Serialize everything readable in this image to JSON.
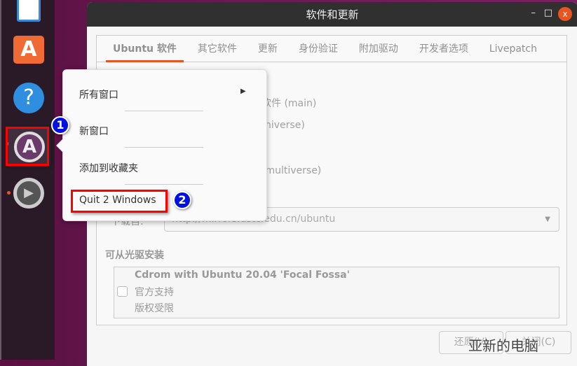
{
  "window": {
    "title": "软件和更新",
    "minimize": "–",
    "maximize": "□",
    "close": "x"
  },
  "tabs": [
    {
      "label": "Ubuntu 软件",
      "active": true
    },
    {
      "label": "其它软件"
    },
    {
      "label": "更新"
    },
    {
      "label": "身份验证"
    },
    {
      "label": "附加驱动"
    },
    {
      "label": "开发者选项"
    },
    {
      "label": "Livepatch"
    }
  ],
  "background_content": {
    "main": "软件 (main)",
    "universe": "niverse)",
    "multiverse": "(multiverse)",
    "download_label": "下载自:",
    "download_server": "http://mirrors.ustc.edu.cn/ubuntu"
  },
  "cdrom": {
    "section": "可从光驱安装",
    "title": "Cdrom with Ubuntu 20.04 'Focal Fossa'",
    "line1": "官方支持",
    "line2": "版权受限",
    "checked": false
  },
  "buttons": {
    "revert": "还原(V)",
    "close": "关闭(C)"
  },
  "context_menu": {
    "items": [
      {
        "label": "所有窗口",
        "submenu": true
      },
      {
        "label": "新窗口"
      },
      {
        "label": "添加到收藏夹"
      },
      {
        "label": "Quit 2 Windows"
      }
    ],
    "submenu_arrow": "▶"
  },
  "annotations": {
    "badge1": "1",
    "badge2": "2",
    "highlight_color": "#ff0000",
    "badge_color": "#0010e0"
  },
  "watermark": "亚新的电脑",
  "dock": {
    "icons": [
      "text-editor-icon",
      "software-store-icon",
      "help-icon",
      "software-updater-icon",
      "settings-icon"
    ]
  },
  "colors": {
    "accent": "#e95420",
    "titlebar": "#303030"
  }
}
